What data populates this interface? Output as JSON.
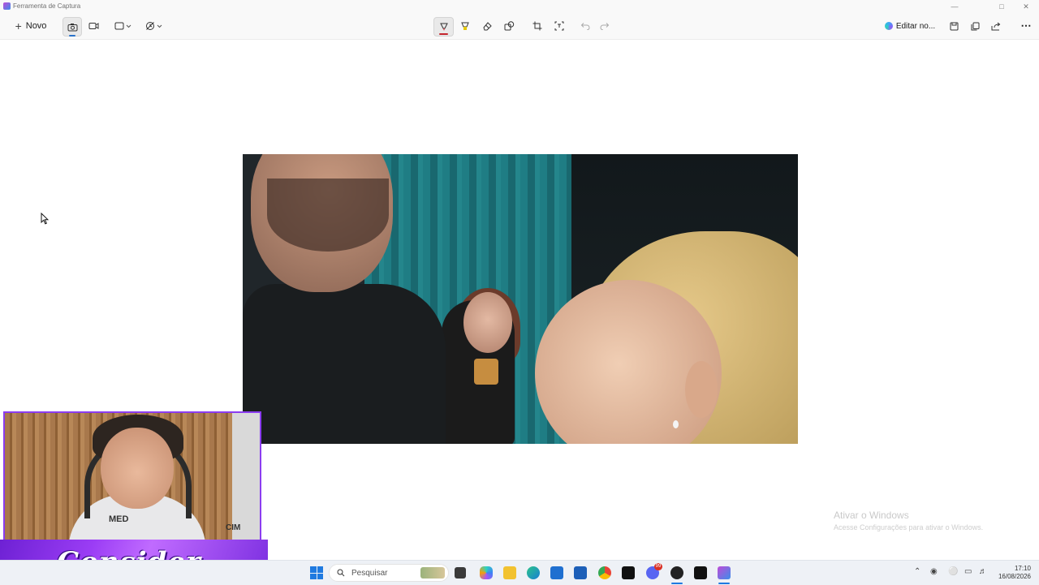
{
  "window": {
    "title": "Ferramenta de Captura",
    "controls": [
      "minimize-icon",
      "maximize-icon",
      "close-icon"
    ]
  },
  "toolbar": {
    "new_label": "Novo",
    "left_tools": [
      "camera-icon",
      "video-icon",
      "rectangle-mode-icon",
      "delay-timer-icon"
    ],
    "center_tools": [
      "ballpoint-pen-icon",
      "highlighter-icon",
      "eraser-icon",
      "shapes-icon",
      "crop-icon",
      "text-actions-icon",
      "undo-icon",
      "redo-icon"
    ],
    "edit_label": "Editar no...",
    "right_tools": [
      "save-icon",
      "copy-icon",
      "share-icon",
      "more-icon"
    ],
    "accent_color": "#c4262e",
    "mode_accent": "#2a72c9"
  },
  "watermark": {
    "title": "Ativar o Windows",
    "subtitle": "Acesse Configurações para ativar o Windows."
  },
  "webcam": {
    "shirt_text_1": "MED",
    "shirt_text_2": "CIM",
    "logo_text": "Consider",
    "border_color": "#8b3cf0"
  },
  "taskbar": {
    "search_placeholder": "Pesquisar",
    "apps": [
      "windows-start-icon",
      "task-view-icon",
      "copilot-icon",
      "file-explorer-icon",
      "edge-icon",
      "store-icon",
      "outlook-icon",
      "chrome-icon",
      "capcut-icon",
      "discord-icon",
      "obs-icon",
      "capcut-icon-2",
      "snipping-tool-icon"
    ],
    "discord_badge": "99",
    "tray": [
      "chevron-up-icon",
      "network-icon",
      "microphone-icon",
      "display-icon",
      "volume-icon"
    ],
    "time": "17:10",
    "date": "16/08/2026"
  }
}
